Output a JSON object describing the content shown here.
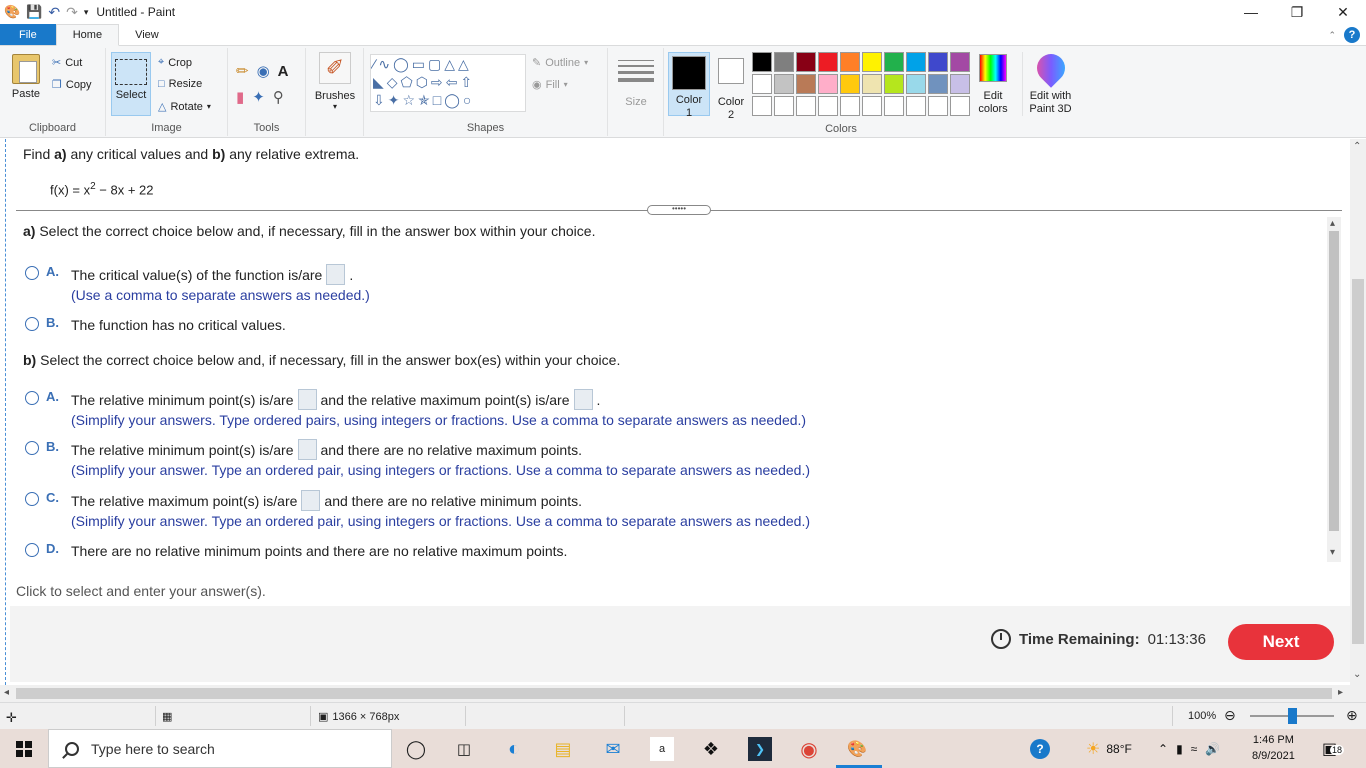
{
  "window": {
    "title": "Untitled - Paint",
    "minimize": "—",
    "restore": "❐",
    "close": "✕"
  },
  "menu": {
    "file": "File",
    "home": "Home",
    "view": "View"
  },
  "ribbon": {
    "clipboard": {
      "paste": "Paste",
      "cut": "Cut",
      "copy": "Copy",
      "label": "Clipboard"
    },
    "image": {
      "select": "Select",
      "crop": "Crop",
      "resize": "Resize",
      "rotate": "Rotate",
      "label": "Image"
    },
    "tools": {
      "label": "Tools",
      "text_tool": "A"
    },
    "brushes": {
      "label": "Brushes"
    },
    "shapes": {
      "outline": "Outline",
      "fill": "Fill",
      "label": "Shapes"
    },
    "size": {
      "label": "Size"
    },
    "colors": {
      "color1": "Color\n1",
      "color2": "Color\n2",
      "edit_colors": "Edit\ncolors",
      "edit_3d": "Edit with\nPaint 3D",
      "label": "Colors",
      "color1_value": "#000000",
      "color2_value": "#ffffff",
      "palette_row1": [
        "#000000",
        "#7f7f7f",
        "#880015",
        "#ed1c24",
        "#ff7f27",
        "#fff200",
        "#22b14c",
        "#00a2e8",
        "#3f48cc",
        "#a349a4"
      ],
      "palette_row2": [
        "#ffffff",
        "#c3c3c3",
        "#b97a57",
        "#ffaec9",
        "#ffc90e",
        "#efe4b0",
        "#b5e61d",
        "#99d9ea",
        "#7092be",
        "#c8bfe7"
      ],
      "palette_row3": [
        "#ffffff",
        "#ffffff",
        "#ffffff",
        "#ffffff",
        "#ffffff",
        "#ffffff",
        "#ffffff",
        "#ffffff",
        "#ffffff",
        "#ffffff"
      ]
    }
  },
  "question": {
    "intro_1": "Find ",
    "intro_a": "a)",
    "intro_2": " any critical values and ",
    "intro_b": "b)",
    "intro_3": " any relative extrema.",
    "function_pre": "f(x) = x",
    "function_exp": "2",
    "function_post": " − 8x + 22",
    "handle": "•••••"
  },
  "part_a": {
    "label": "a)",
    "title": " Select the correct choice below and, if necessary, fill in the answer box within your choice.",
    "choices": [
      {
        "letter": "A.",
        "text_pre": "The critical value(s) of the function is/are",
        "text_post": ".",
        "hint": "(Use a comma to separate answers as needed.)"
      },
      {
        "letter": "B.",
        "text_pre": "The function has no critical values."
      }
    ]
  },
  "part_b": {
    "label": "b)",
    "title": " Select the correct choice below and, if necessary, fill in the answer box(es) within your choice.",
    "choices": [
      {
        "letter": "A.",
        "text_pre": "The relative minimum point(s) is/are",
        "text_mid": "and the relative maximum point(s) is/are",
        "text_post": ".",
        "hint": "(Simplify your answers. Type ordered pairs, using integers or fractions. Use a comma to separate answers as needed.)"
      },
      {
        "letter": "B.",
        "text_pre": "The relative minimum point(s) is/are",
        "text_post": "and there are no relative maximum points.",
        "hint": "(Simplify your answer. Type an ordered pair, using integers or fractions. Use a comma to separate answers as needed.)"
      },
      {
        "letter": "C.",
        "text_pre": "The relative maximum point(s) is/are",
        "text_post": "and there are no relative minimum points.",
        "hint": "(Simplify your answer. Type an ordered pair, using integers or fractions. Use a comma to separate answers as needed.)"
      },
      {
        "letter": "D.",
        "text_pre": "There are no relative minimum points and there are no relative maximum points."
      }
    ]
  },
  "footer": {
    "instruction": "Click to select and enter your answer(s).",
    "time_label": "Time Remaining:",
    "time_value": "01:13:36",
    "next": "Next"
  },
  "statusbar": {
    "canvas_size": "1366 × 768px",
    "zoom": "100%"
  },
  "taskbar": {
    "search_placeholder": "Type here to search",
    "weather": "88°F",
    "time": "1:46 PM",
    "date": "8/9/2021",
    "notification_count": "18"
  }
}
